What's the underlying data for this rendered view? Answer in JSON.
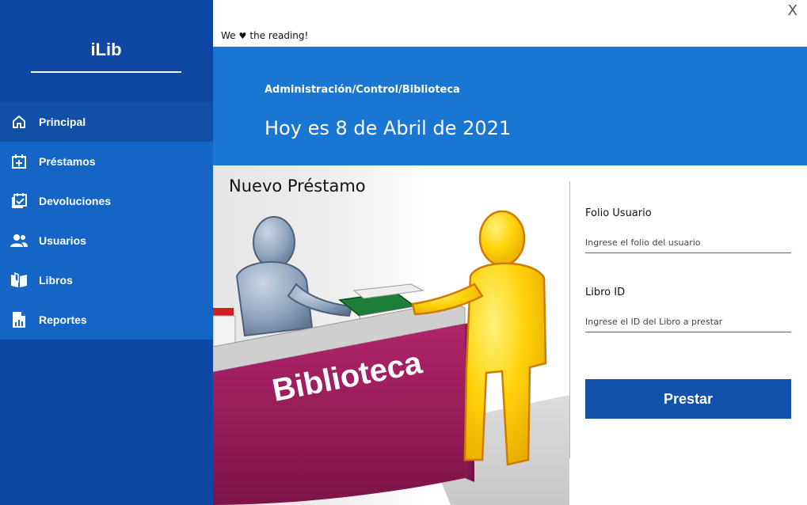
{
  "app": {
    "brand": "iLib",
    "tagline_before": "We",
    "tagline_after": "the reading!",
    "close_label": "X"
  },
  "sidebar": {
    "items": [
      {
        "label": "Principal",
        "icon": "home-icon"
      },
      {
        "label": "Préstamos",
        "icon": "calendar-plus-icon"
      },
      {
        "label": "Devoluciones",
        "icon": "calendar-check-icon"
      },
      {
        "label": "Usuarios",
        "icon": "users-icon"
      },
      {
        "label": "Libros",
        "icon": "book-open-icon"
      },
      {
        "label": "Reportes",
        "icon": "report-icon"
      }
    ],
    "active_index": 0
  },
  "header": {
    "breadcrumb": "Administración/Control/Biblioteca",
    "date_text": "Hoy es 8 de Abril de 2021"
  },
  "illustration": {
    "title": "Nuevo Préstamo",
    "counter_text": "Biblioteca"
  },
  "form": {
    "folio_label": "Folio Usuario",
    "folio_placeholder": "Ingrese el folio del usuario",
    "libro_label": "Libro ID",
    "libro_placeholder": "Ingrese el ID del Libro a prestar",
    "submit_label": "Prestar"
  },
  "colors": {
    "sidebar": "#0f47a5",
    "nav_block": "#1565c7",
    "banner": "#1976d2",
    "button": "#1052ac",
    "counter": "#9b1b5a"
  }
}
